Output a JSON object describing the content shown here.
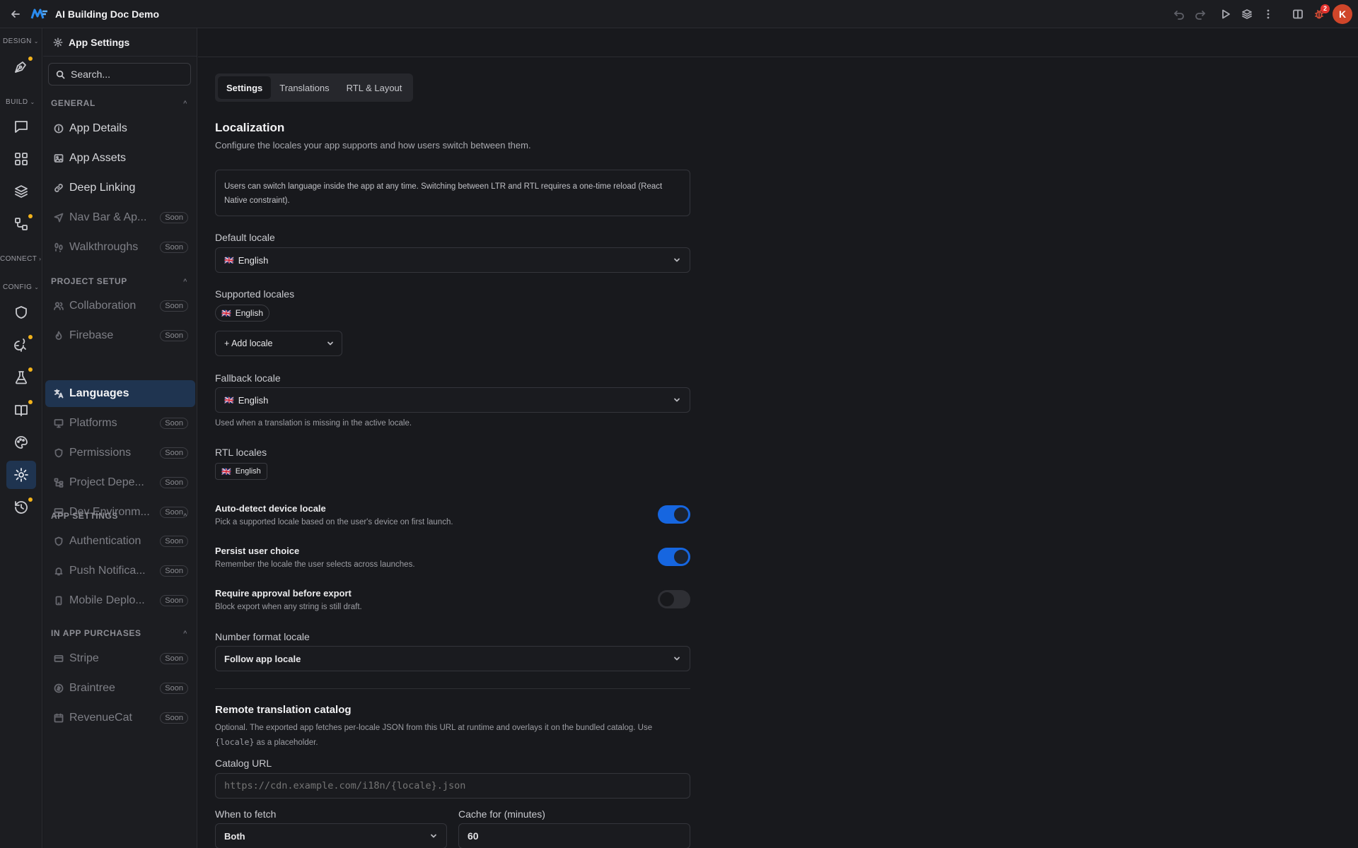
{
  "app": {
    "title": "AI Building Doc Demo",
    "avatar_initial": "K",
    "notification_count": "2"
  },
  "rail": {
    "sections": {
      "design": "DESIGN",
      "build": "BUILD",
      "connect": "CONNECT",
      "config": "CONFIG"
    }
  },
  "sidebar": {
    "title": "App Settings",
    "search_placeholder": "Search...",
    "soon_label": "Soon",
    "groups": {
      "general": "GENERAL",
      "project_setup": "PROJECT SETUP",
      "app_settings": "APP SETTINGS",
      "iap": "IN APP PURCHASES"
    },
    "items": {
      "app_details": "App Details",
      "app_assets": "App Assets",
      "deep_linking": "Deep Linking",
      "nav_bar": "Nav Bar & Ap...",
      "walkthroughs": "Walkthroughs",
      "collaboration": "Collaboration",
      "firebase": "Firebase",
      "languages": "Languages",
      "platforms": "Platforms",
      "permissions": "Permissions",
      "project_deps": "Project Depe...",
      "dev_env": "Dev Environm...",
      "authentication": "Authentication",
      "push": "Push Notifica...",
      "mobile_deploy": "Mobile Deplo...",
      "stripe": "Stripe",
      "braintree": "Braintree",
      "revenuecat": "RevenueCat"
    }
  },
  "tabs": {
    "settings": "Settings",
    "translations": "Translations",
    "rtl": "RTL & Layout"
  },
  "localization": {
    "title": "Localization",
    "description": "Configure the locales your app supports and how users switch between them.",
    "note": "Users can switch language inside the app at any time. Switching between LTR and RTL requires a one-time reload (React Native constraint).",
    "default_locale_label": "Default locale",
    "default_locale_value": "English",
    "supported_locales_label": "Supported locales",
    "supported_locale_chip": "English",
    "add_locale_label": "+ Add locale",
    "fallback_locale_label": "Fallback locale",
    "fallback_locale_value": "English",
    "fallback_hint": "Used when a translation is missing in the active locale.",
    "rtl_locales_label": "RTL locales",
    "rtl_locale_chip": "English",
    "flag": "🇬🇧",
    "auto_detect_title": "Auto-detect device locale",
    "auto_detect_desc": "Pick a supported locale based on the user's device on first launch.",
    "auto_detect_on": true,
    "persist_title": "Persist user choice",
    "persist_desc": "Remember the locale the user selects across launches.",
    "persist_on": true,
    "approval_title": "Require approval before export",
    "approval_desc": "Block export when any string is still draft.",
    "approval_on": false,
    "number_format_label": "Number format locale",
    "number_format_value": "Follow app locale"
  },
  "remote_catalog": {
    "title": "Remote translation catalog",
    "desc_part1": "Optional. The exported app fetches per-locale JSON from this URL at runtime and overlays it on the bundled catalog. Use",
    "desc_code": "{locale}",
    "desc_part2": "as a placeholder.",
    "catalog_url_label": "Catalog URL",
    "catalog_url_placeholder": "https://cdn.example.com/i18n/{locale}.json",
    "when_to_fetch_label": "When to fetch",
    "when_to_fetch_value": "Both",
    "cache_label": "Cache for (minutes)",
    "cache_value": "60"
  },
  "colors": {
    "accent": "#1666e0",
    "active_bg": "#1f3450",
    "dot": "#f2b21b",
    "avatar": "#d0462a"
  }
}
